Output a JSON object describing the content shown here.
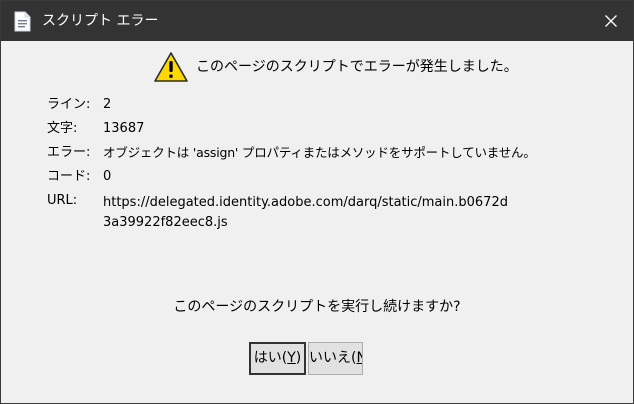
{
  "window": {
    "title": "スクリプト エラー",
    "close_glyph": "✕"
  },
  "message": {
    "headline": "このページのスクリプトでエラーが発生しました。"
  },
  "details": {
    "line_label": "ライン:",
    "line_value": "2",
    "char_label": "文字:",
    "char_value": "13687",
    "error_label": "エラー:",
    "error_value": "オブジェクトは 'assign' プロパティまたはメソッドをサポートしていません。",
    "code_label": "コード:",
    "code_value": "0",
    "url_label": "URL:",
    "url_value_line1": "https://delegated.identity.adobe.com/darq/static/main.b0672d",
    "url_value_line2": "3a39922f82eec8.js"
  },
  "question": "このページのスクリプトを実行し続けますか?",
  "buttons": {
    "yes_label": "はい(",
    "yes_mnemonic": "Y",
    "yes_close": ")",
    "no_label": "いいえ(",
    "no_mnemonic": "N"
  },
  "icons": {
    "title_icon": "document-icon",
    "warning_icon": "warning-triangle-icon",
    "close_icon": "close-icon"
  },
  "colors": {
    "titlebar": "#333333",
    "dialog_background": "#f0f0f0",
    "warning_yellow": "#ffd800"
  }
}
